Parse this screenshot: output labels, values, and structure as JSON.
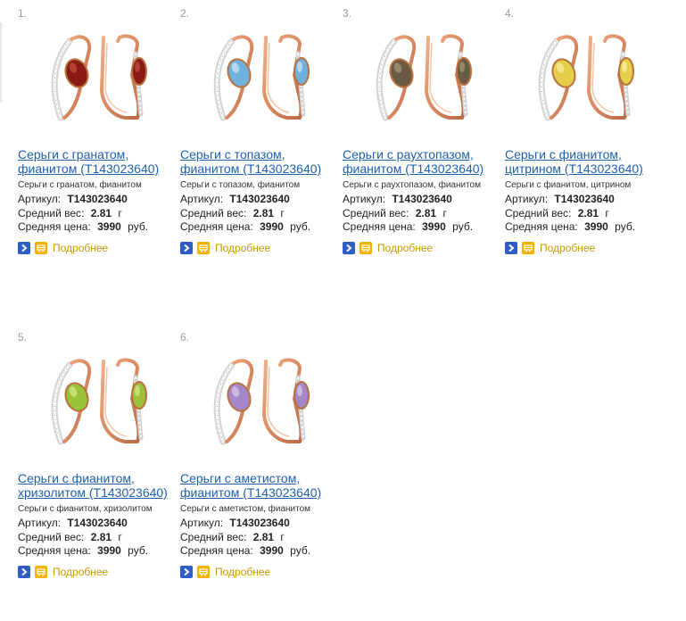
{
  "products": [
    {
      "number": "1.",
      "title_line1": "Серьги с гранатом,",
      "title_line2": "фианитом (Т143023640)",
      "subtitle": "Серьги с гранатом, фианитом",
      "article_label": "Артикул:",
      "article_value": "Т143023640",
      "weight_label": "Средний вес:",
      "weight_value": "2.81",
      "weight_unit": "г",
      "price_label": "Средняя цена:",
      "price_value": "3990",
      "price_unit": "руб.",
      "more_label": "Подробнее",
      "stone_color": "#8a1a14",
      "stone_highlight": "#c65040"
    },
    {
      "number": "2.",
      "title_line1": "Серьги с топазом,",
      "title_line2": "фианитом (Т143023640)",
      "subtitle": "Серьги с топазом, фианитом",
      "article_label": "Артикул:",
      "article_value": "Т143023640",
      "weight_label": "Средний вес:",
      "weight_value": "2.81",
      "weight_unit": "г",
      "price_label": "Средняя цена:",
      "price_value": "3990",
      "price_unit": "руб.",
      "more_label": "Подробнее",
      "stone_color": "#6fb0dc",
      "stone_highlight": "#cfe9f8"
    },
    {
      "number": "3.",
      "title_line1": "Серьги с раухтопазом,",
      "title_line2": "фианитом (Т143023640)",
      "subtitle": "Серьги с раухтопазом, фианитом",
      "article_label": "Артикул:",
      "article_value": "Т143023640",
      "weight_label": "Средний вес:",
      "weight_value": "2.81",
      "weight_unit": "г",
      "price_label": "Средняя цена:",
      "price_value": "3990",
      "price_unit": "руб.",
      "more_label": "Подробнее",
      "stone_color": "#6a5a44",
      "stone_highlight": "#a89878"
    },
    {
      "number": "4.",
      "title_line1": "Серьги с фианитом,",
      "title_line2": "цитрином (Т143023640)",
      "subtitle": "Серьги с фианитом, цитрином",
      "article_label": "Артикул:",
      "article_value": "Т143023640",
      "weight_label": "Средний вес:",
      "weight_value": "2.81",
      "weight_unit": "г",
      "price_label": "Средняя цена:",
      "price_value": "3990",
      "price_unit": "руб.",
      "more_label": "Подробнее",
      "stone_color": "#e5cf4a",
      "stone_highlight": "#f8efa8"
    },
    {
      "number": "5.",
      "title_line1": "Серьги с фианитом,",
      "title_line2": "хризолитом (Т143023640)",
      "subtitle": "Серьги с фианитом, хризолитом",
      "article_label": "Артикул:",
      "article_value": "Т143023640",
      "weight_label": "Средний вес:",
      "weight_value": "2.81",
      "weight_unit": "г",
      "price_label": "Средняя цена:",
      "price_value": "3990",
      "price_unit": "руб.",
      "more_label": "Подробнее",
      "stone_color": "#9ac23a",
      "stone_highlight": "#d6ec8a"
    },
    {
      "number": "6.",
      "title_line1": "Серьги с аметистом,",
      "title_line2": "фианитом (Т143023640)",
      "subtitle": "Серьги с аметистом, фианитом",
      "article_label": "Артикул:",
      "article_value": "Т143023640",
      "weight_label": "Средний вес:",
      "weight_value": "2.81",
      "weight_unit": "г",
      "price_label": "Средняя цена:",
      "price_value": "3990",
      "price_unit": "руб.",
      "more_label": "Подробнее",
      "stone_color": "#a487c8",
      "stone_highlight": "#ddcdf0"
    }
  ],
  "icons": {
    "details": "chevron-right-icon",
    "cart": "cart-icon"
  },
  "colors": {
    "link": "#1f5fad",
    "more_link": "#c79a00",
    "gold_metal": "#d98a62",
    "arrow_button": "#2f5cc5",
    "cart_button": "#f2b400"
  }
}
